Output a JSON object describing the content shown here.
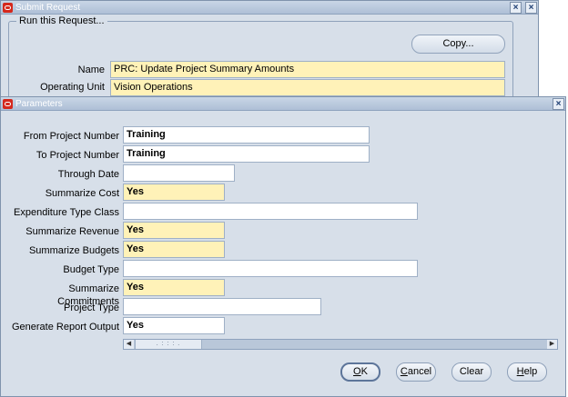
{
  "submit_window": {
    "title": "Submit Request",
    "group_title": "Run this Request...",
    "copy_label": "Copy...",
    "name_label": "Name",
    "name_value": "PRC: Update Project Summary Amounts",
    "operating_unit_label": "Operating Unit",
    "operating_unit_value": "Vision Operations"
  },
  "parameters_window": {
    "title": "Parameters",
    "fields": [
      {
        "label": "From Project Number",
        "value": "Training"
      },
      {
        "label": "To Project Number",
        "value": "Training"
      },
      {
        "label": "Through Date",
        "value": ""
      },
      {
        "label": "Summarize Cost",
        "value": "Yes"
      },
      {
        "label": "Expenditure Type Class",
        "value": ""
      },
      {
        "label": "Summarize Revenue",
        "value": "Yes"
      },
      {
        "label": "Summarize Budgets",
        "value": "Yes"
      },
      {
        "label": "Budget Type",
        "value": ""
      },
      {
        "label": "Summarize Commitments",
        "value": "Yes"
      },
      {
        "label": "Project Type",
        "value": ""
      },
      {
        "label": "Generate Report Output",
        "value": "Yes"
      }
    ],
    "scroll_grip": ". : : : .",
    "buttons": {
      "ok": {
        "mnemonic": "O",
        "rest": "K"
      },
      "cancel": {
        "mnemonic": "C",
        "rest": "ancel"
      },
      "clear": {
        "label": "Clear"
      },
      "help": {
        "mnemonic": "H",
        "rest": "elp"
      }
    }
  },
  "colors": {
    "required_field": "#fff2b8",
    "window_bg": "#d7dfe9",
    "brand_red": "#d5281c"
  }
}
